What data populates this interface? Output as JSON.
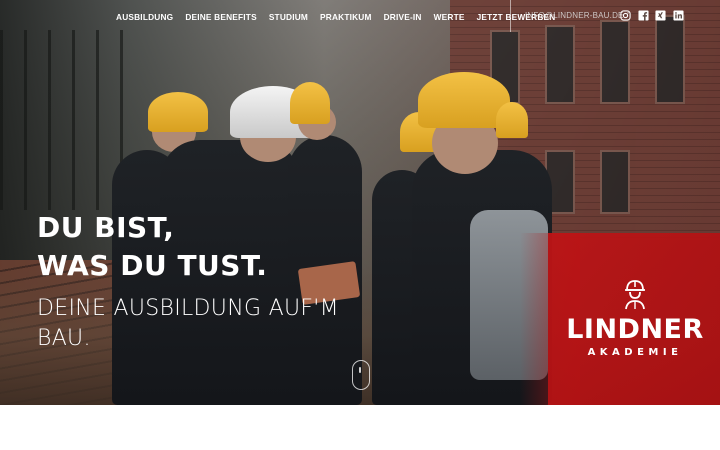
{
  "nav": {
    "items": [
      "AUSBILDUNG",
      "DEINE BENEFITS",
      "STUDIUM",
      "PRAKTIKUM",
      "DRIVE-IN",
      "WERTE",
      "JETZT BEWERBEN"
    ],
    "email": "INFO@LINDNER-BAU.DE",
    "social": [
      "instagram-icon",
      "facebook-icon",
      "xing-icon",
      "linkedin-icon"
    ]
  },
  "hero": {
    "headline_line1": "DU BIST,",
    "headline_line2": "WAS DU TUST.",
    "sub_line1": "DEINE AUSBILDUNG AUF'M",
    "sub_line2": "BAU."
  },
  "logo": {
    "title": "LINDNER",
    "subtitle": "AKADEMIE"
  },
  "colors": {
    "accent_red": "#be1416",
    "helmet_yellow": "#f3c145",
    "text": "#ffffff"
  }
}
